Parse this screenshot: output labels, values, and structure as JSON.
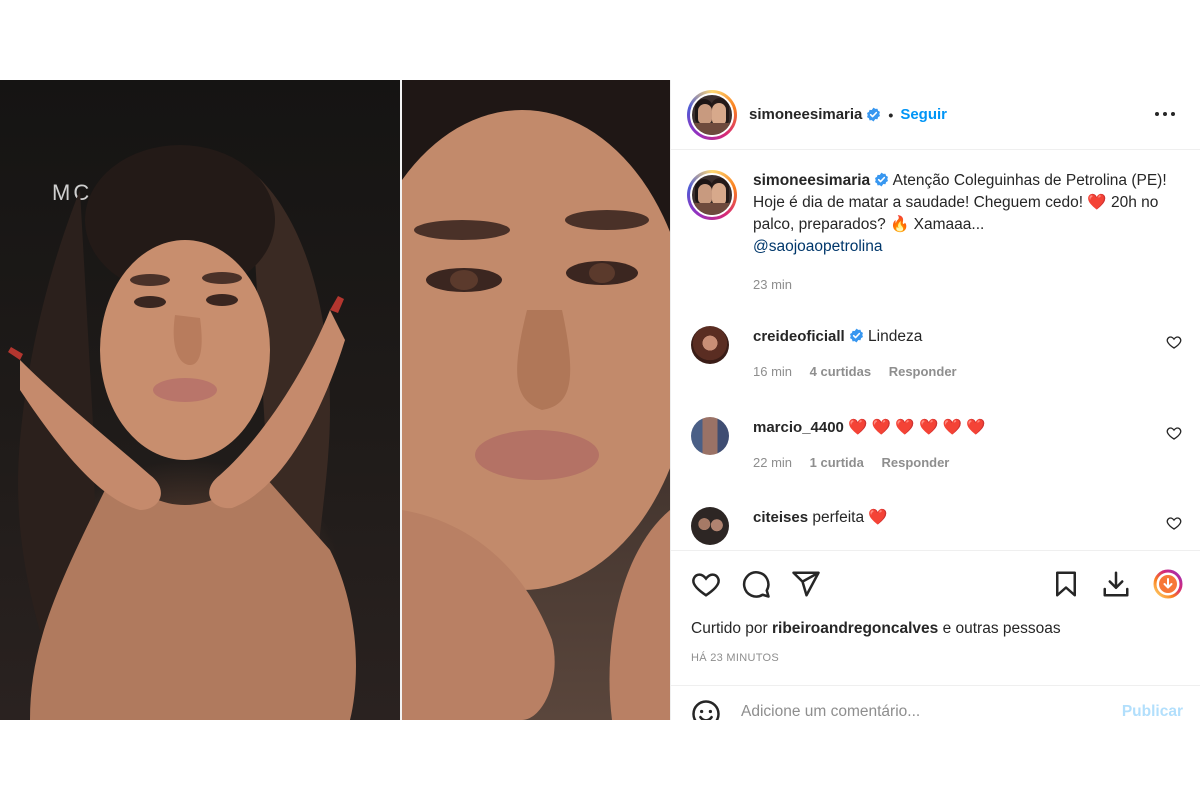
{
  "post": {
    "username": "simoneesimaria",
    "follow_label": "Seguir",
    "dot": "•",
    "caption": {
      "username": "simoneesimaria",
      "text_1": "Atenção Coleguinhas de Petrolina (PE)! Hoje é dia de matar a saudade! Cheguem cedo!",
      "heart": "❤️",
      "text_2": "20h no palco, preparados?",
      "fire": "🔥",
      "text_3": "Xamaaa...",
      "mention": "@saojoaopetrolina",
      "time": "23 min"
    },
    "photo_watermark": "MC"
  },
  "comments": [
    {
      "username": "creideoficiall",
      "verified": true,
      "text": "Lindeza",
      "time": "16 min",
      "likes": "4 curtidas",
      "reply": "Responder"
    },
    {
      "username": "marcio_4400",
      "verified": false,
      "text": "❤️ ❤️ ❤️ ❤️ ❤️ ❤️",
      "time": "22 min",
      "likes": "1 curtida",
      "reply": "Responder"
    },
    {
      "username": "citeises",
      "verified": false,
      "text": "perfeita ❤️"
    }
  ],
  "actions": {
    "liked_by_prefix": "Curtido por",
    "liked_by_user": "ribeiroandregoncalves",
    "liked_by_suffix": "e outras pessoas",
    "posted_ago": "HÁ 23 MINUTOS"
  },
  "comment_box": {
    "placeholder": "Adicione um comentário...",
    "publish_label": "Publicar"
  },
  "colors": {
    "link_blue": "#0095f6",
    "verified_blue": "#3897f0",
    "heart_red": "#ed4956",
    "muted": "#8e8e8e"
  },
  "icons": [
    "verified-icon",
    "more-options-icon",
    "heart-icon",
    "comment-icon",
    "share-icon",
    "bookmark-icon",
    "download-icon",
    "story-ring-icon",
    "emoji-icon"
  ]
}
